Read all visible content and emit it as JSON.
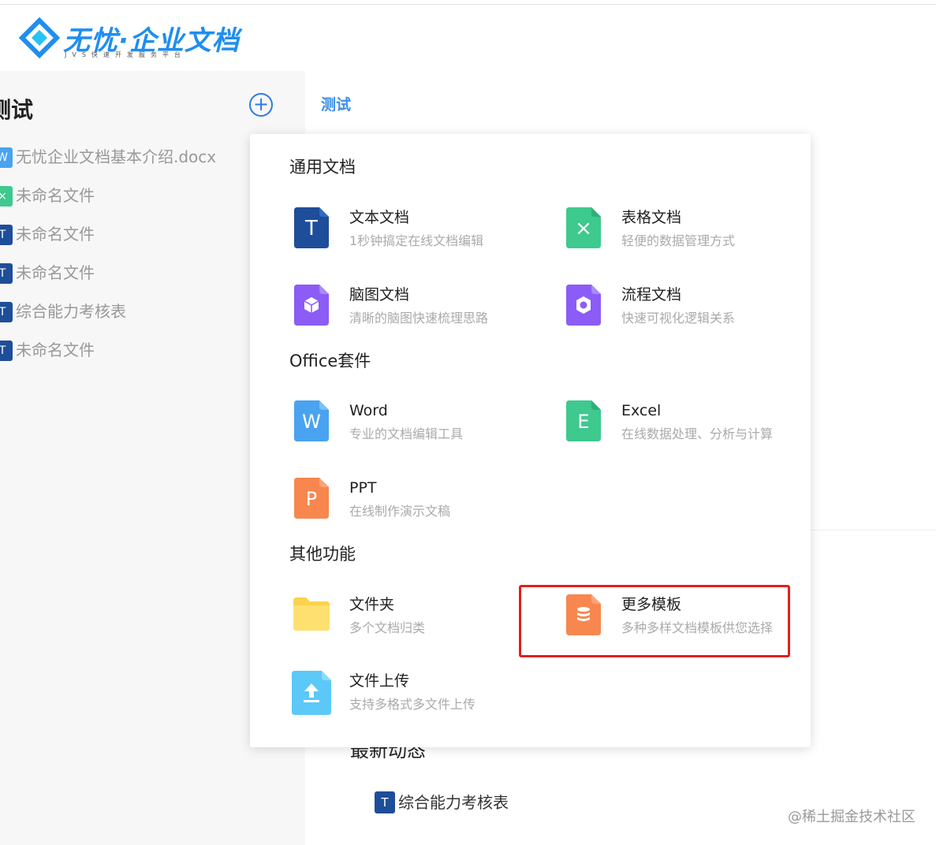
{
  "logo": {
    "title": "无忧·企业文档",
    "subtitle": "JVS快速开发服务平台",
    "color": "#1f8ef1"
  },
  "sidebar": {
    "space_title": "测试",
    "add_symbol": "+",
    "files": [
      {
        "label": "无忧企业文档基本介绍.docx",
        "icon": "word-icon",
        "glyph": "W",
        "color": "#4aa3f0"
      },
      {
        "label": "未命名文件",
        "icon": "sheet-icon",
        "glyph": "×",
        "color": "#3ec98e"
      },
      {
        "label": "未命名文件",
        "icon": "text-doc-icon",
        "glyph": "T",
        "color": "#1e4e9a"
      },
      {
        "label": "未命名文件",
        "icon": "text-doc-icon",
        "glyph": "T",
        "color": "#1e4e9a"
      },
      {
        "label": "综合能力考核表",
        "icon": "text-doc-icon",
        "glyph": "T",
        "color": "#1e4e9a"
      },
      {
        "label": "未命名文件",
        "icon": "text-doc-icon",
        "glyph": "T",
        "color": "#1e4e9a"
      }
    ]
  },
  "main": {
    "breadcrumb": "测试",
    "activity_title": "最新动态",
    "activity_item": {
      "label": "综合能力考核表",
      "glyph": "T"
    },
    "watermark": "@稀土掘金技术社区"
  },
  "popover": {
    "sections": {
      "general": "通用文档",
      "office": "Office套件",
      "other": "其他功能"
    },
    "options": {
      "text_doc": {
        "name": "文本文档",
        "desc": "1秒钟搞定在线文档编辑",
        "color": "#1e4e9a",
        "glyph": "T"
      },
      "sheet_doc": {
        "name": "表格文档",
        "desc": "轻便的数据管理方式",
        "color": "#3ec98e",
        "glyph": "×"
      },
      "mind_doc": {
        "name": "脑图文档",
        "desc": "清晰的脑图快速梳理思路",
        "color": "#8b5cf6"
      },
      "flow_doc": {
        "name": "流程文档",
        "desc": "快速可视化逻辑关系",
        "color": "#8b5cf6"
      },
      "word": {
        "name": "Word",
        "desc": "专业的文档编辑工具",
        "color": "#4aa3f0",
        "glyph": "W"
      },
      "excel": {
        "name": "Excel",
        "desc": "在线数据处理、分析与计算",
        "color": "#3ec98e",
        "glyph": "E"
      },
      "ppt": {
        "name": "PPT",
        "desc": "在线制作演示文稿",
        "color": "#f7874e",
        "glyph": "P"
      },
      "folder": {
        "name": "文件夹",
        "desc": "多个文档归类",
        "color": "#fbd24e"
      },
      "templates": {
        "name": "更多模板",
        "desc": "多种多样文档模板供您选择",
        "color": "#f7874e"
      },
      "upload": {
        "name": "文件上传",
        "desc": "支持多格式多文件上传",
        "color": "#5cc8f7"
      }
    },
    "highlight_color": "#e0211b"
  }
}
